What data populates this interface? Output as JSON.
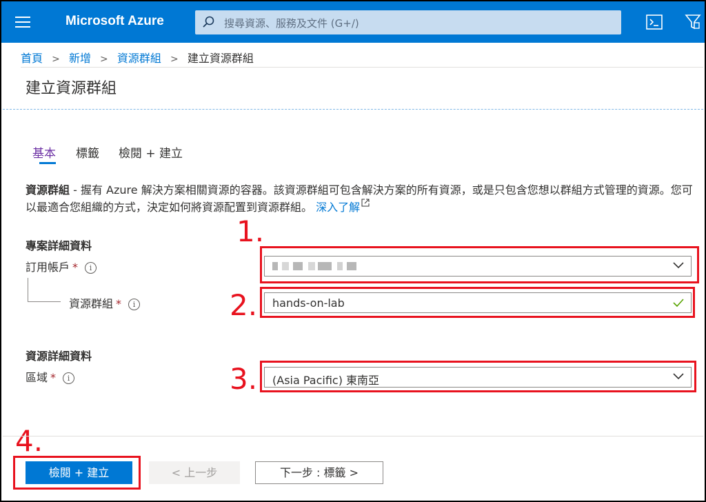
{
  "topbar": {
    "brand": "Microsoft Azure",
    "search_placeholder": "搜尋資源、服務及文件 (G+/)",
    "icons": [
      "menu-icon",
      "search-icon",
      "cloud-shell-icon",
      "directory-filter-icon"
    ]
  },
  "breadcrumb": {
    "items": [
      "首頁",
      "新增",
      "資源群組"
    ],
    "current": "建立資源群組",
    "separator": ">"
  },
  "page": {
    "title": "建立資源群組"
  },
  "tabs": [
    "基本",
    "標籤",
    "檢閱 + 建立"
  ],
  "active_tab": "基本",
  "description": {
    "bold": "資源群組",
    "text": " - 握有 Azure 解決方案相關資源的容器。該資源群組可包含解決方案的所有資源，或是只包含您想以群組方式管理的資源。您可以最適合您組織的方式，決定如何將資源配置到資源群組。",
    "link": "深入了解"
  },
  "project_details": {
    "heading": "專案詳細資料",
    "subscription_label": "訂用帳戶",
    "resource_group_label": "資源群組",
    "resource_group_value": "hands-on-lab"
  },
  "resource_details": {
    "heading": "資源詳細資料",
    "region_label": "區域",
    "region_value": "(Asia Pacific) 東南亞"
  },
  "required_mark": "*",
  "info_mark": "i",
  "annotations": [
    "1.",
    "2.",
    "3.",
    "4."
  ],
  "footer": {
    "review_create": "檢閱 + 建立",
    "previous": "< 上一步",
    "next": "下一步 : 標籤 >"
  },
  "colors": {
    "topbar": "#0078d4",
    "accent": "#0078d4",
    "annotation": "#e8121e",
    "active_tab": "#6b2fa3",
    "valid_check": "#57a300"
  }
}
